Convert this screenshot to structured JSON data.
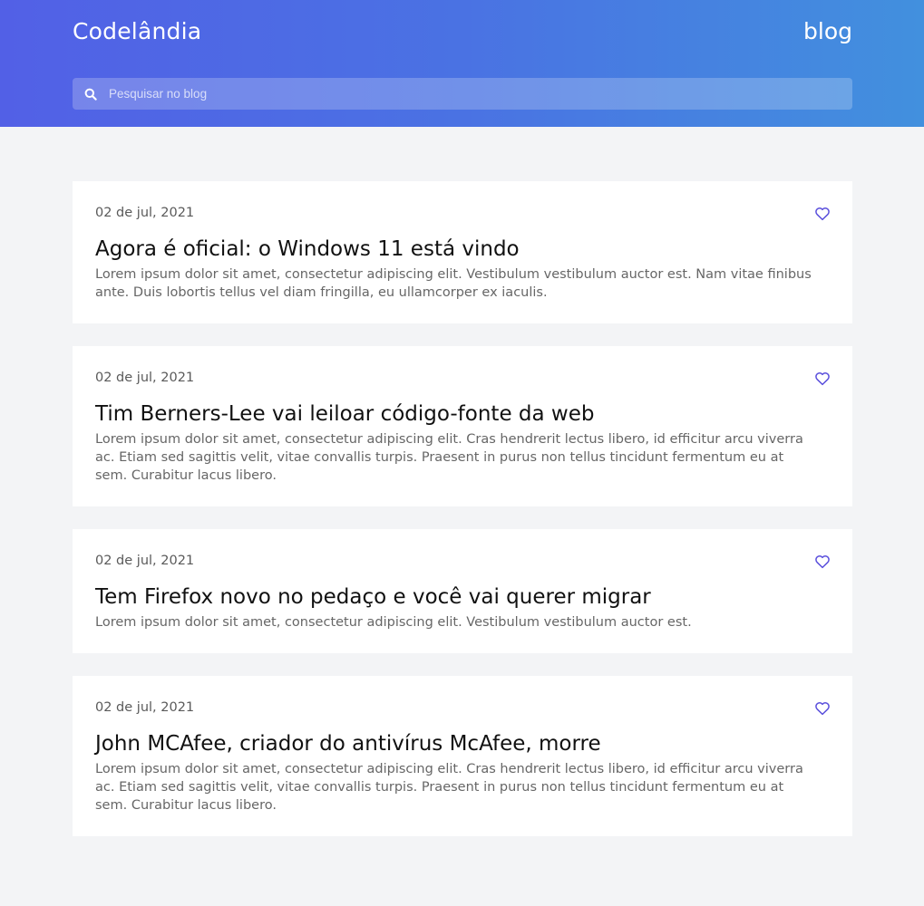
{
  "header": {
    "brand": "Codelândia",
    "nav_link": "blog",
    "search_placeholder": "Pesquisar no blog",
    "search_value": ""
  },
  "colors": {
    "header_gradient_start": "#5260e6",
    "header_gradient_end": "#4290de",
    "heart_accent": "#5a4fdc",
    "page_background": "#f3f4f6"
  },
  "posts": [
    {
      "date": "02 de jul, 2021",
      "title": "Agora é oficial: o Windows 11 está vindo",
      "excerpt": "Lorem ipsum dolor sit amet, consectetur adipiscing elit. Vestibulum vestibulum auctor est. Nam vitae finibus ante. Duis lobortis tellus vel diam fringilla, eu ullamcorper ex iaculis.",
      "icon": "heart-outline-icon"
    },
    {
      "date": "02 de jul, 2021",
      "title": "Tim Berners-Lee vai leiloar código-fonte da web",
      "excerpt": "Lorem ipsum dolor sit amet, consectetur adipiscing elit. Cras hendrerit lectus libero, id efficitur arcu viverra ac. Etiam sed sagittis velit, vitae convallis turpis. Praesent in purus non tellus tincidunt fermentum eu at sem. Curabitur lacus libero.",
      "icon": "heart-outline-icon"
    },
    {
      "date": "02 de jul, 2021",
      "title": "Tem Firefox novo no pedaço e você vai querer migrar",
      "excerpt": "Lorem ipsum dolor sit amet, consectetur adipiscing elit. Vestibulum vestibulum auctor est.",
      "icon": "heart-outline-icon"
    },
    {
      "date": "02 de jul, 2021",
      "title": "John MCAfee, criador do antivírus McAfee, morre",
      "excerpt": "Lorem ipsum dolor sit amet, consectetur adipiscing elit. Cras hendrerit lectus libero, id efficitur arcu viverra ac. Etiam sed sagittis velit, vitae convallis turpis. Praesent in purus non tellus tincidunt fermentum eu at sem. Curabitur lacus libero.",
      "icon": "heart-outline-icon"
    }
  ]
}
